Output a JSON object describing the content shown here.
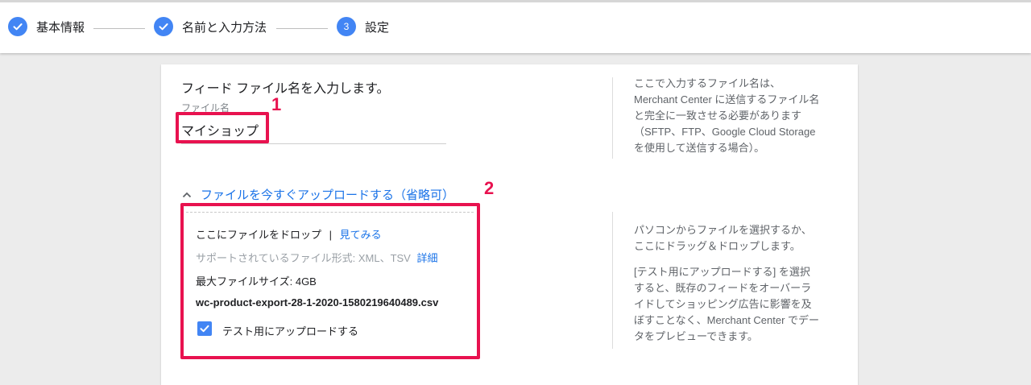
{
  "stepper": {
    "steps": [
      {
        "label": "基本情報",
        "state": "complete"
      },
      {
        "label": "名前と入力方法",
        "state": "complete"
      },
      {
        "label": "設定",
        "number": "3",
        "state": "current"
      }
    ]
  },
  "form": {
    "title": "フィード ファイル名を入力します。",
    "file_name_label": "ファイル名",
    "file_name_value": "マイショップ",
    "help_file_name": {
      "line1": "ここで入力するファイル名は、",
      "line2": "Merchant Center に送信するファイル名",
      "line3": "と完全に一致させる必要があります",
      "line4": "（SFTP、FTP、Google Cloud Storage",
      "line5": "を使用して送信する場合）。"
    },
    "upload_toggle_label": "ファイルを今すぐアップロードする（省略可）",
    "dropzone": {
      "drop_text": "ここにファイルをドロップ",
      "separator": "|",
      "browse_link": "見てみる",
      "supported_formats": "サポートされているファイル形式: XML、TSV",
      "details_link": "詳細",
      "max_size": "最大ファイルサイズ: 4GB",
      "file_name": "wc-product-export-28-1-2020-1580219640489.csv",
      "test_upload_label": "テスト用にアップロードする",
      "test_upload_checked": true
    },
    "help_upload": {
      "p1_line1": "パソコンからファイルを選択するか、",
      "p1_line2": "ここにドラッグ＆ドロップします。",
      "p2_line1": "[テスト用にアップロードする] を選択",
      "p2_line2": "すると、既存のフィードをオーバーラ",
      "p2_line3": "イドしてショッピング広告に影響を及",
      "p2_line4": "ぼすことなく、Merchant Center でデー",
      "p2_line5": "タをプレビューできます。"
    }
  },
  "annotations": {
    "marker1": "1",
    "marker2": "2",
    "color": "#e8124f"
  },
  "colors": {
    "accent": "#4285f4",
    "link": "#1a73e8"
  }
}
